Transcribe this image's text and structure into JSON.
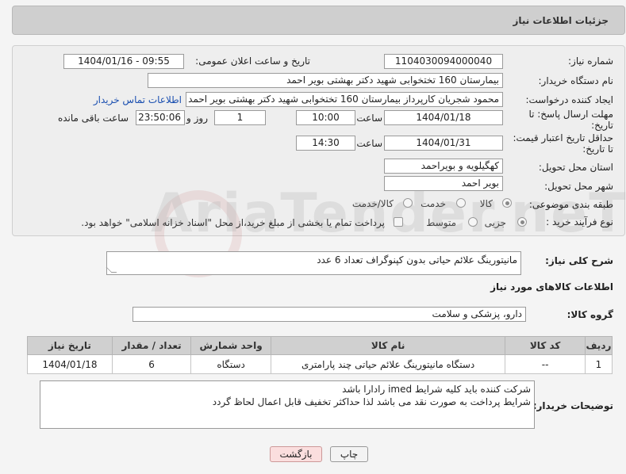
{
  "page_title": "جزئیات اطلاعات نیاز",
  "fields": {
    "need_number_label": "شماره نیاز:",
    "need_number": "1104030094000040",
    "announce_label": "تاریخ و ساعت اعلان عمومی:",
    "announce_value": "1404/01/16 - 09:55",
    "buyer_org_label": "نام دستگاه خریدار:",
    "buyer_org": "بیمارستان 160 تختخوابی شهید دکتر بهشتی بویر احمد",
    "creator_label": "ایجاد کننده درخواست:",
    "creator": "محمود شجریان کارپرداز بیمارستان 160 تختخوابی شهید دکتر بهشتی بویر احمد",
    "contact_link": "اطلاعات تماس خریدار",
    "deadline_label": "مهلت ارسال پاسخ: تا تاریخ:",
    "deadline_date": "1404/01/18",
    "time_label": "ساعت",
    "deadline_time": "10:00",
    "days_value": "1",
    "days_label": "روز و",
    "remaining_time": "23:50:06",
    "remaining_label": "ساعت باقی مانده",
    "price_validity_label": "حداقل تاریخ اعتبار قیمت: تا تاریخ:",
    "price_validity_date": "1404/01/31",
    "price_validity_time": "14:30",
    "province_label": "استان محل تحویل:",
    "province": "کهگیلویه و بویراحمد",
    "city_label": "شهر محل تحویل:",
    "city": "بویر احمد",
    "category_label": "طبقه بندی موضوعی:",
    "category_options": [
      "کالا",
      "خدمت",
      "کالا/خدمت"
    ],
    "process_label": "نوع فرآیند خرید :",
    "process_options": [
      "جزیی",
      "متوسط"
    ],
    "payment_note": "پرداخت تمام یا بخشی از مبلغ خرید،از محل \"اسناد خزانه اسلامی\" خواهد بود."
  },
  "summary": {
    "label": "شرح کلی نیاز:",
    "value": "مانیتورینگ علائم حیاتی بدون کپنوگراف تعداد 6 عدد"
  },
  "goods_info_title": "اطلاعات کالاهای مورد نیاز",
  "goods_group": {
    "label": "گروه کالا:",
    "value": "دارو، پزشکی و سلامت"
  },
  "table": {
    "headers": [
      "ردیف",
      "کد کالا",
      "نام کالا",
      "واحد شمارش",
      "تعداد / مقدار",
      "تاریخ نیاز"
    ],
    "rows": [
      [
        "1",
        "--",
        "دستگاه مانیتورینگ علائم حیاتی چند پارامتری",
        "دستگاه",
        "6",
        "1404/01/18"
      ]
    ]
  },
  "buyer_notes": {
    "label": "توضیحات خریدار:",
    "line1": "شرکت کننده باید کلیه شرایط  imed  رادارا باشد",
    "line2": "شرایط پرداخت به صورت نقد می باشد لذا حداکثر تخفیف قابل اعمال لحاظ گردد"
  },
  "buttons": {
    "print": "چاپ",
    "back": "بازگشت"
  },
  "watermark_text": "AriaTender.neT"
}
